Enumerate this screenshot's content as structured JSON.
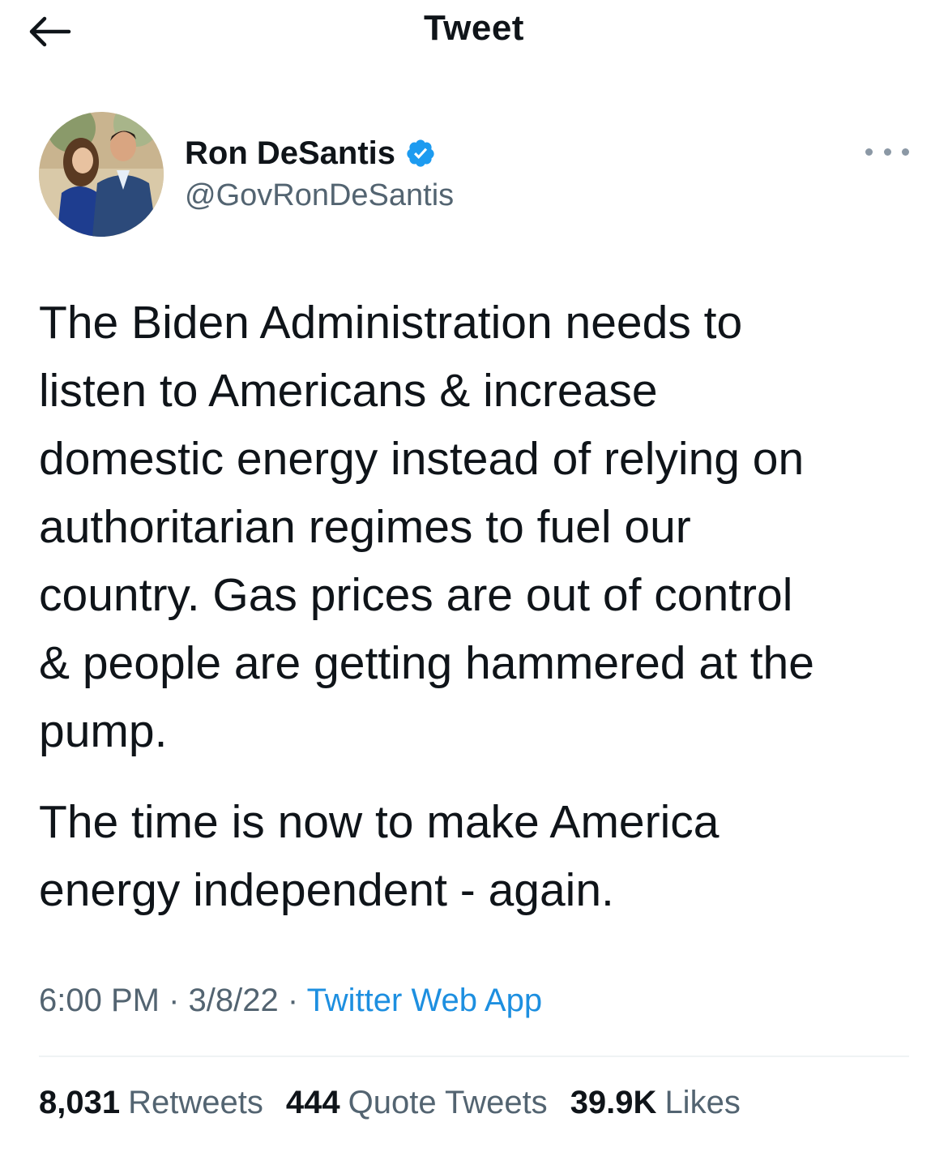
{
  "header": {
    "title": "Tweet",
    "back_icon": "arrow-left-icon"
  },
  "author": {
    "display_name": "Ron DeSantis",
    "handle": "@GovRonDeSantis",
    "verified_icon": "verified-badge-icon",
    "verified_color": "#1d9bf0",
    "more_icon": "ellipsis-icon"
  },
  "tweet": {
    "paragraph_1": "The Biden Administration needs to\nlisten to Americans & increase\ndomestic energy instead of relying on\nauthoritarian regimes to fuel our\ncountry. Gas prices are out of control\n& people are getting hammered at the\npump.",
    "paragraph_2": "The time is now to make America\nenergy independent - again."
  },
  "meta": {
    "time": "6:00 PM",
    "separator": " · ",
    "date": "3/8/22",
    "source": "Twitter Web App"
  },
  "stats": {
    "retweets_count": "8,031",
    "retweets_label": "Retweets",
    "quotes_count": "444",
    "quotes_label": "Quote Tweets",
    "likes_count": "39.9K",
    "likes_label": "Likes"
  }
}
